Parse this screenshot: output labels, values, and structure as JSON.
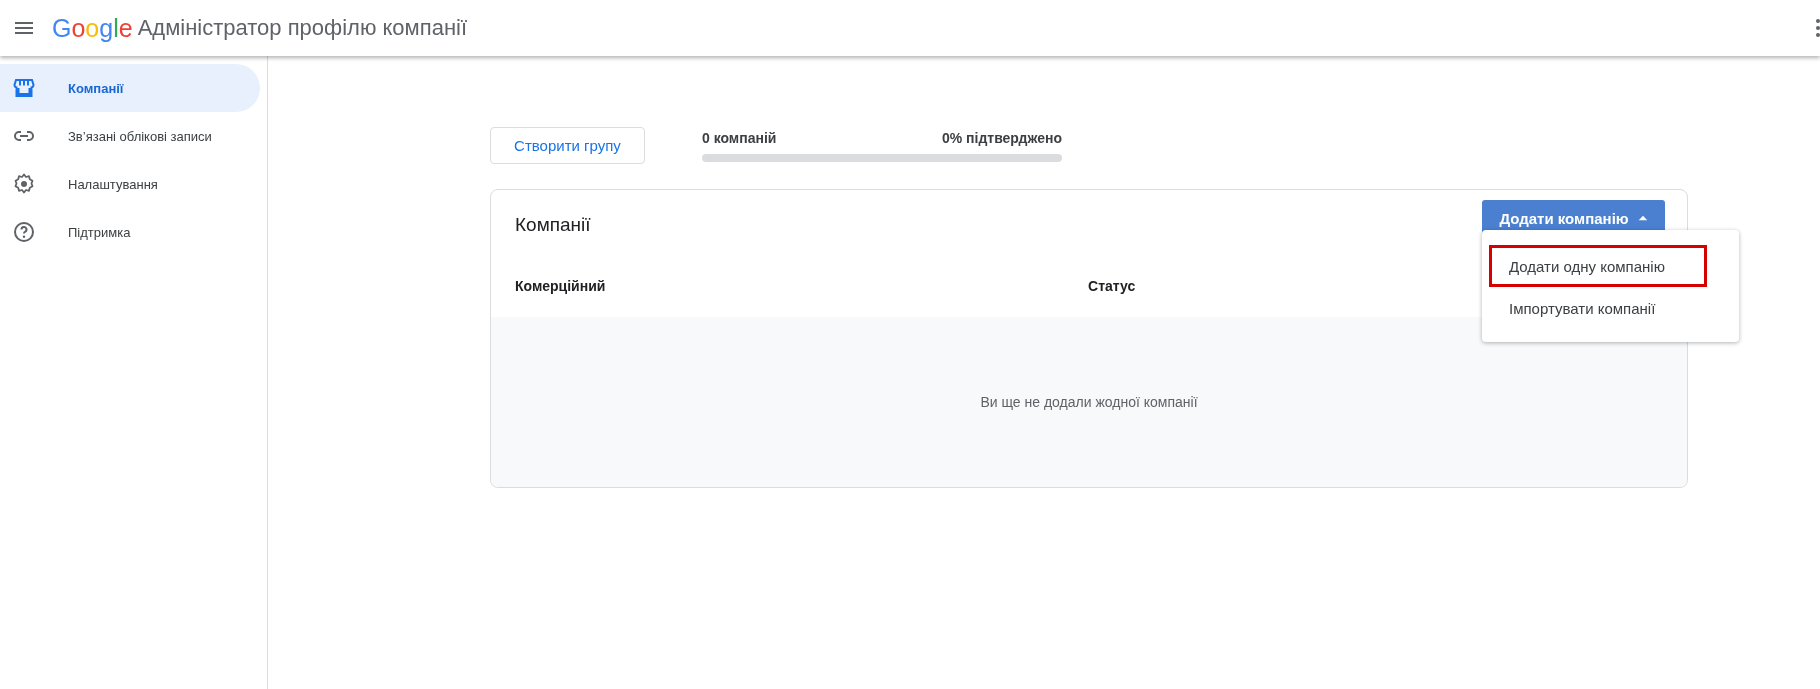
{
  "header": {
    "logo": [
      {
        "letter": "G",
        "color": "#4285f4"
      },
      {
        "letter": "o",
        "color": "#ea4335"
      },
      {
        "letter": "o",
        "color": "#fbbc05"
      },
      {
        "letter": "g",
        "color": "#4285f4"
      },
      {
        "letter": "l",
        "color": "#34a853"
      },
      {
        "letter": "e",
        "color": "#ea4335"
      }
    ],
    "title": "Адміністратор профілю компанії"
  },
  "sidebar": {
    "items": [
      {
        "kind": "store",
        "label": "Компанії",
        "selected": true
      },
      {
        "kind": "link",
        "label": "Зв’язані облікові записи",
        "selected": false
      },
      {
        "kind": "settings",
        "label": "Налаштування",
        "selected": false
      },
      {
        "kind": "help",
        "label": "Підтримка",
        "selected": false
      }
    ]
  },
  "toolbar": {
    "create_group_button": "Створити групу",
    "count": "0 компаній",
    "verified": "0% підтверджено",
    "level": 0
  },
  "card": {
    "title": "Компанії",
    "add_button": "Додати компанію",
    "menu": [
      {
        "label": "Додати одну компанію",
        "highlighted": true
      },
      {
        "label": "Імпортувати компанії",
        "highlighted": false
      }
    ],
    "columns": [
      "Комерційний",
      "Статус"
    ],
    "empty_text": "Ви ще не додали жодної компанії"
  }
}
